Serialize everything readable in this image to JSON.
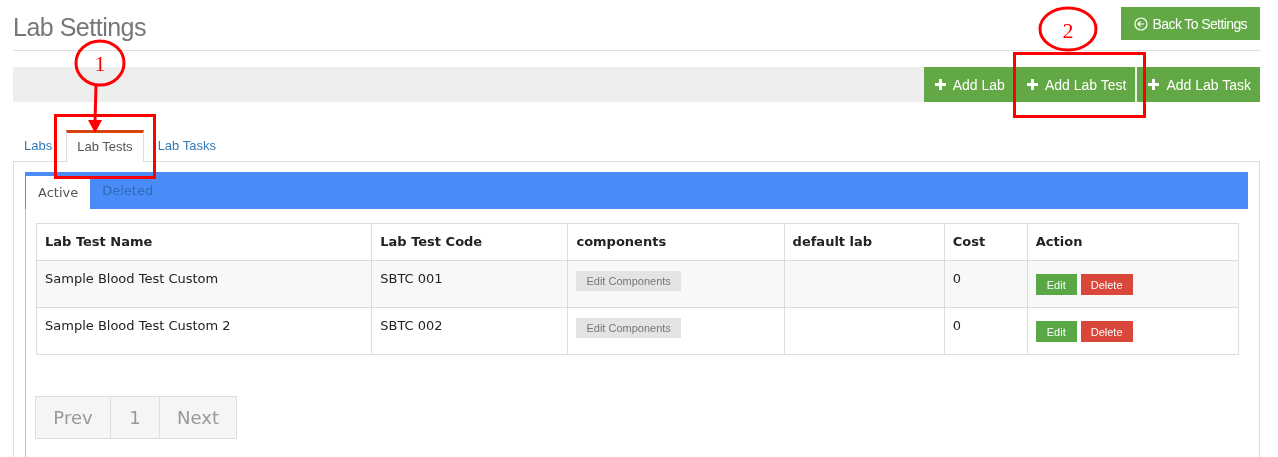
{
  "page_title": "Lab Settings",
  "back_button": "Back To Settings",
  "toolbar_buttons": [
    "Add Lab",
    "Add Lab Test",
    "Add Lab Task"
  ],
  "tabs": [
    {
      "label": "Labs",
      "selected": false
    },
    {
      "label": "Lab Tests",
      "selected": true
    },
    {
      "label": "Lab Tasks",
      "selected": false
    }
  ],
  "subtabs": [
    {
      "label": "Active",
      "selected": true
    },
    {
      "label": "Deleted",
      "selected": false
    }
  ],
  "table": {
    "columns": [
      "Lab Test Name",
      "Lab Test Code",
      "components",
      "default lab",
      "Cost",
      "Action"
    ],
    "rows": [
      {
        "name": "Sample Blood Test Custom",
        "code": "SBTC 001",
        "components_button": "Edit Components",
        "default_lab": "",
        "cost": "0",
        "edit": "Edit",
        "delete": "Delete"
      },
      {
        "name": "Sample Blood Test Custom 2",
        "code": "SBTC 002",
        "components_button": "Edit Components",
        "default_lab": "",
        "cost": "0",
        "edit": "Edit",
        "delete": "Delete"
      }
    ]
  },
  "pagination": {
    "prev": "Prev",
    "pages": [
      "1"
    ],
    "next": "Next"
  },
  "annotations": [
    {
      "label": "1"
    },
    {
      "label": "2"
    }
  ]
}
